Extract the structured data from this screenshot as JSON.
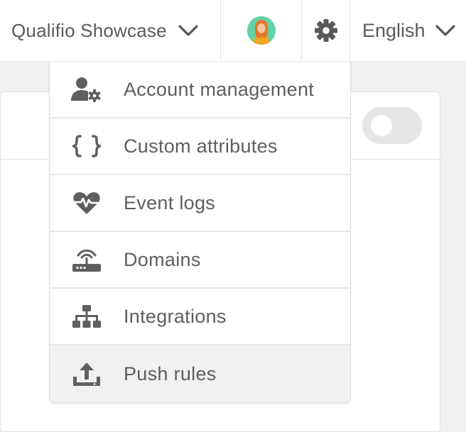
{
  "header": {
    "workspace_label": "Qualifio Showcase",
    "language_label": "English"
  },
  "settings_menu": {
    "items": [
      {
        "label": "Account management",
        "icon": "user-gear-icon"
      },
      {
        "label": "Custom attributes",
        "icon": "curly-braces-icon"
      },
      {
        "label": "Event logs",
        "icon": "heartbeat-icon"
      },
      {
        "label": "Domains",
        "icon": "router-icon"
      },
      {
        "label": "Integrations",
        "icon": "sitemap-icon"
      },
      {
        "label": "Push rules",
        "icon": "upload-icon",
        "hovered": true
      }
    ]
  },
  "panel": {
    "toggle_on": false
  },
  "colors": {
    "text": "#5d5d5d",
    "icon": "#5f5f5f",
    "border": "#e4e4e4",
    "hover_bg": "#f1f1f1",
    "toggle_bg": "#e6e6e6"
  }
}
